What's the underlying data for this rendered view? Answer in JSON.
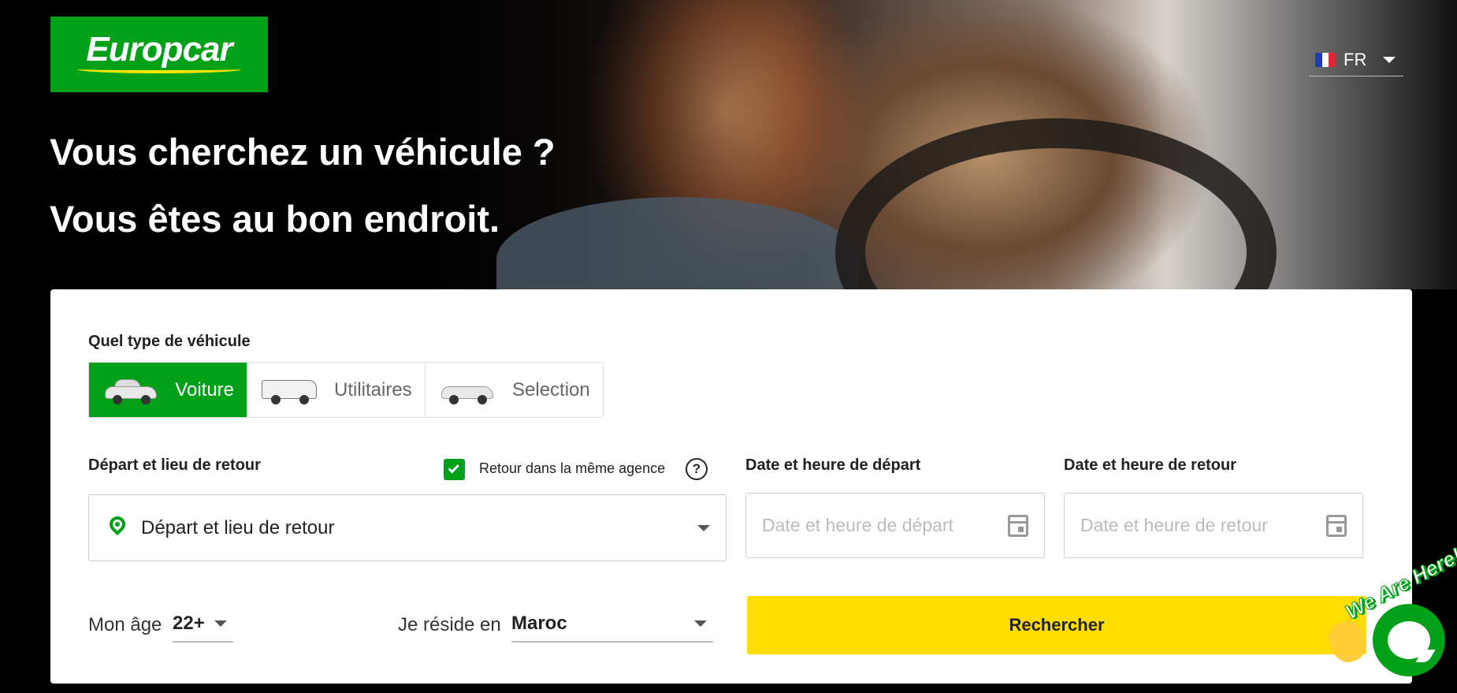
{
  "header": {
    "logo_text": "Europcar",
    "language": {
      "code": "FR",
      "flag_colors": [
        "#1a3fb5",
        "#ffffff",
        "#e32636"
      ]
    }
  },
  "hero": {
    "headline_1": "Vous cherchez un véhicule ?",
    "headline_2": "Vous êtes au bon endroit."
  },
  "search": {
    "vehicle_type_label": "Quel type de véhicule",
    "vehicle_tabs": [
      {
        "label": "Voiture",
        "active": true
      },
      {
        "label": "Utilitaires",
        "active": false
      },
      {
        "label": "Selection",
        "active": false
      }
    ],
    "location_label": "Départ et lieu de retour",
    "same_agency_label": "Retour dans la même agence",
    "same_agency_checked": true,
    "location_placeholder": "Départ et lieu de retour",
    "start_date_label": "Date et heure de départ",
    "start_date_placeholder": "Date et heure de départ",
    "end_date_label": "Date et heure de retour",
    "end_date_placeholder": "Date et heure de retour",
    "age_label": "Mon âge",
    "age_value": "22+",
    "residence_label": "Je réside en",
    "residence_value": "Maroc",
    "search_button": "Rechercher"
  },
  "chat": {
    "tagline": "We Are Here!"
  },
  "colors": {
    "brand_green": "#00a019",
    "button_yellow": "#ffdd00"
  }
}
